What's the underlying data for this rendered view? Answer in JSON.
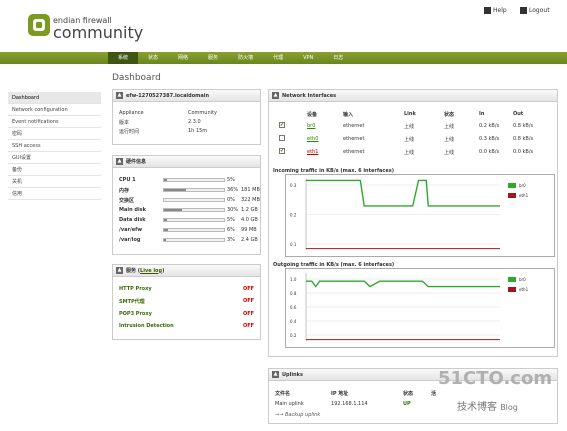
{
  "header": {
    "logo_line1": "endian firewall",
    "logo_line2": "community",
    "help": "Help",
    "logout": "Logout"
  },
  "nav": {
    "tabs": [
      "系统",
      "状态",
      "网络",
      "服务",
      "防火墙",
      "代理",
      "VPN",
      "日志"
    ],
    "active": 0
  },
  "sidebar": {
    "items": [
      "Dashboard",
      "Network configuration",
      "Event notifications",
      "密码",
      "SSH access",
      "GUI设置",
      "备份",
      "关机",
      "信用"
    ]
  },
  "page_title": "Dashboard",
  "system_panel": {
    "title": "efw-1270527387.localdomain",
    "rows": [
      {
        "label": "Appliance",
        "value": "Community"
      },
      {
        "label": "版本",
        "value": "2.3.0"
      },
      {
        "label": "运行时间",
        "value": "1h 15m"
      }
    ]
  },
  "hardware_panel": {
    "title": "硬件信息",
    "rows": [
      {
        "label": "CPU 1",
        "pct": "5%",
        "frac": 0.05,
        "size": ""
      },
      {
        "label": "内存",
        "pct": "36%",
        "frac": 0.36,
        "size": "181 MB"
      },
      {
        "label": "交换区",
        "pct": "0%",
        "frac": 0.0,
        "size": "322 MB"
      },
      {
        "label": "Main disk",
        "pct": "30%",
        "frac": 0.3,
        "size": "1.2 GB"
      },
      {
        "label": "Data disk",
        "pct": "5%",
        "frac": 0.05,
        "size": "4.0 GB"
      },
      {
        "label": "/var/efw",
        "pct": "6%",
        "frac": 0.06,
        "size": "99 MB"
      },
      {
        "label": "/var/log",
        "pct": "3%",
        "frac": 0.03,
        "size": "2.4 GB"
      }
    ]
  },
  "services_panel": {
    "title": "服务",
    "live_log": "Live log",
    "rows": [
      {
        "name": "HTTP Proxy",
        "state": "OFF"
      },
      {
        "name": "SMTP代理",
        "state": "OFF"
      },
      {
        "name": "POP3 Proxy",
        "state": "OFF"
      },
      {
        "name": "Intrusion Detection",
        "state": "OFF"
      }
    ]
  },
  "network_panel": {
    "title": "Network Interfaces",
    "headers": [
      "设备",
      "输入",
      "Link",
      "状态",
      "In",
      "Out"
    ],
    "rows": [
      {
        "device": "br0",
        "type": "ethernet",
        "link": "上线",
        "state": "上线",
        "in": "0.2 kB/s",
        "out": "0.8 kB/s",
        "checked": true,
        "color": "#2a8a00"
      },
      {
        "device": "eth0",
        "type": "ethernet",
        "link": "上线",
        "state": "上线",
        "in": "0.3 kB/s",
        "out": "0.8 kB/s",
        "checked": false,
        "color": "#2a8a00"
      },
      {
        "device": "eth1",
        "type": "ethernet",
        "link": "上线",
        "state": "上线",
        "in": "0.0 kB/s",
        "out": "0.0 kB/s",
        "checked": true,
        "color": "#cc0000"
      }
    ],
    "in_title": "Incoming traffic in KB/s (max. 6 interfaces)",
    "out_title": "Outgoing traffic in KB/s (max. 6 interfaces)",
    "in_ticks": [
      "0.3",
      "0.2",
      "0.1"
    ],
    "out_ticks": [
      "1.0",
      "0.8",
      "0.6",
      "0.4",
      "0.2"
    ],
    "legend": [
      {
        "name": "br0",
        "color": "#2ea82e"
      },
      {
        "name": "eth1",
        "color": "#a01818"
      }
    ]
  },
  "uplinks_panel": {
    "title": "Uplinks",
    "headers": [
      "文件名",
      "IP 地址",
      "状态",
      "活"
    ],
    "row": {
      "name": "Main uplink",
      "ip": "192.168.1.114",
      "state": "UP"
    },
    "backup": "→→ Backup uplink"
  },
  "watermark": {
    "line1": "51CTO.com",
    "line2": "技术博客",
    "blog": "Blog"
  }
}
